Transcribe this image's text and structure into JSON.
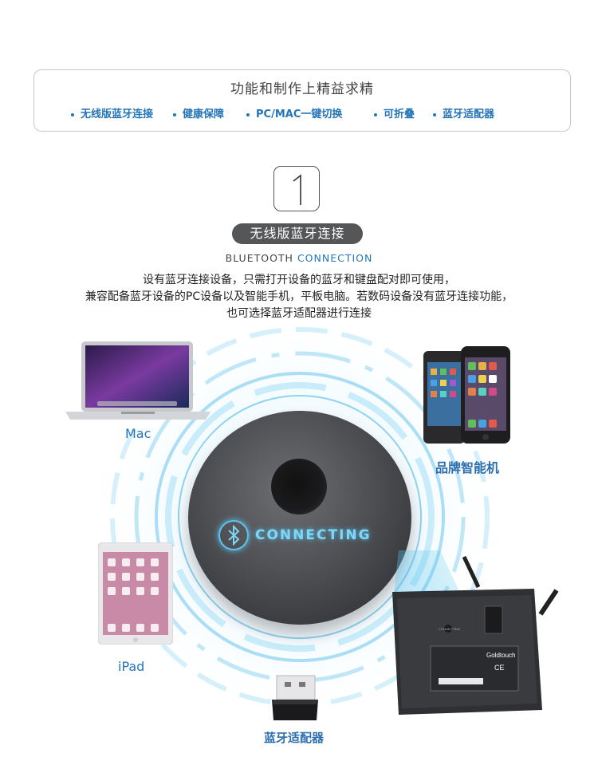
{
  "header": {
    "title": "功能和制作上精益求精",
    "features": [
      "无线版蓝牙连接",
      "健康保障",
      "PC/MAC一键切换",
      "可折叠",
      "蓝牙适配器"
    ]
  },
  "section": {
    "number": "1",
    "title": "无线版蓝牙连接",
    "subtitle_plain": "BLUETOOTH",
    "subtitle_accent": "CONNECTION",
    "description": [
      "设有蓝牙连接设备，只需打开设备的蓝牙和键盘配对即可使用，",
      "兼容配备蓝牙设备的PC设备以及智能手机，平板电脑。若数码设备没有蓝牙连接功能，",
      "也可选择蓝牙适配器进行连接"
    ]
  },
  "sphere": {
    "text": "CONNECTING",
    "icon": "bluetooth-icon"
  },
  "devices": {
    "mac": "Mac",
    "phone": "品牌智能机",
    "ipad": "iPad",
    "adapter": "蓝牙适配器"
  },
  "keyboard": {
    "brand": "Goldtouch",
    "small_text": "CONNECTING",
    "ce_mark": "CE"
  },
  "colors": {
    "accent": "#2475b8",
    "glow": "#5bc5ef",
    "pill": "#555657"
  }
}
